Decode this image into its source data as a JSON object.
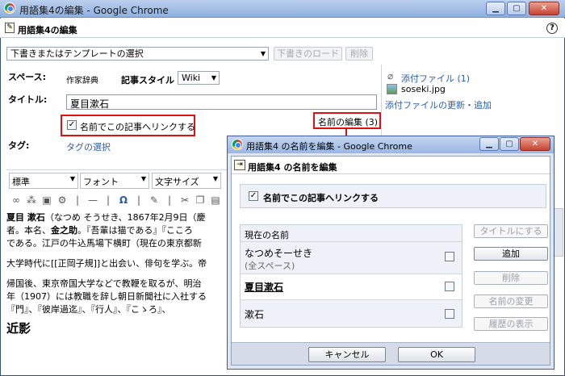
{
  "window": {
    "title": "用語集4の編集 - Google Chrome"
  },
  "header": {
    "title": "用語集4の編集",
    "help": "?"
  },
  "toolbar": {
    "template_select": "下書きまたはテンプレートの選択",
    "load_draft": "下書きのロード",
    "delete": "削除"
  },
  "space": {
    "label": "スペース:",
    "value": "作家辞典",
    "style_label": "記事スタイル",
    "style_value": "Wiki"
  },
  "attachments": {
    "title": "添付ファイル (1)",
    "file": "soseki.jpg",
    "manage": "添付ファイルの更新・追加"
  },
  "title_field": {
    "label": "タイトル:",
    "value": "夏目漱石",
    "link_checkbox": "名前でこの記事へリンクする",
    "names_edit": "名前の編集 (3)"
  },
  "tags": {
    "label": "タグ:",
    "select": "タグの選択"
  },
  "editor": {
    "format": "標準",
    "font": "フォント",
    "size": "文字サイズ",
    "para1_bold": "夏目 漱石",
    "para1_rest1": "（なつめ そうせき、1867年2月9日（慶",
    "para1_line2a": "者。本名、",
    "para1_bold2": "金之助",
    "para1_line2b": "。『吾輩は猫である』『こころ",
    "para1_line3": "である。江戸の牛込馬場下横町（現在の東京都新",
    "para2": "大学時代に[[正岡子規]]と出会い、俳句を学ぶ。帝",
    "para3_line1": "帰国後、東京帝国大学などで教鞭を取るが、明治",
    "para3_line2": "年（1907）には教職を辞し朝日新聞社に入社する",
    "para3_line3": "『門』、『彼岸過迄』、『行人』、『こゝろ』、",
    "heading": "近影"
  },
  "dialog": {
    "window_title": "用語集4 の名前を編集 - Google Chrome",
    "title": "用語集4 の名前を編集",
    "link_checkbox": "名前でこの記事へリンクする",
    "list_header": "現在の名前",
    "names": [
      {
        "name": "なつめそーせき",
        "sub": "(全スペース)"
      },
      {
        "name": "夏目漱石",
        "sub": ""
      },
      {
        "name": "漱石",
        "sub": ""
      }
    ],
    "buttons": {
      "make_title": "タイトルにする",
      "add": "追加",
      "delete": "削除",
      "rename": "名前の変更",
      "history": "履歴の表示"
    },
    "cancel": "キャンセル",
    "ok": "OK"
  },
  "colors": {
    "accent": "#2a5db0",
    "highlight": "#e01010"
  }
}
